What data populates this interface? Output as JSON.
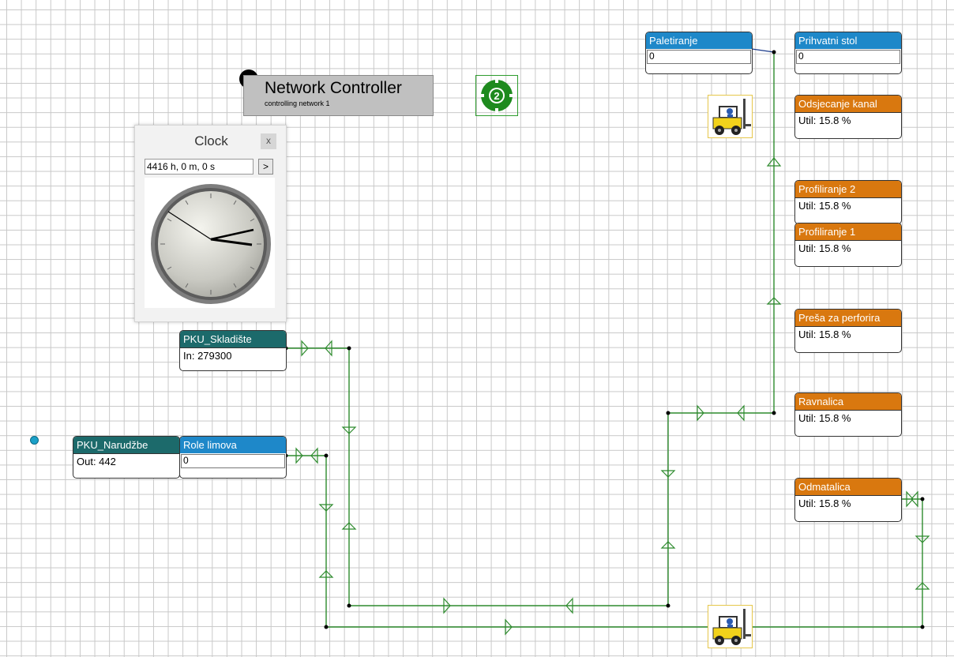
{
  "network_controller": {
    "title": "Network Controller",
    "subtitle": "controlling network 1"
  },
  "network_badge": {
    "label": "2"
  },
  "clock": {
    "title": "Clock",
    "close": "x",
    "time": "4416 h, 0 m, 0 s",
    "go": ">"
  },
  "nodes": {
    "paletiranje": {
      "header": "Paletiranje",
      "value": "0"
    },
    "prihvatni_stol": {
      "header": "Prihvatni stol",
      "value": "0"
    },
    "odsjecanje_kanal": {
      "header": "Odsjecanje kanal",
      "value": "Util: 15.8 %"
    },
    "profiliranje_2": {
      "header": "Profiliranje 2",
      "value": "Util: 15.8 %"
    },
    "profiliranje_1": {
      "header": "Profiliranje 1",
      "value": "Util: 15.8 %"
    },
    "presa_za_perforira": {
      "header": "Preša za perforira",
      "value": "Util: 15.8 %"
    },
    "ravnalica": {
      "header": "Ravnalica",
      "value": "Util: 15.8 %"
    },
    "odmatalica": {
      "header": "Odmatalica",
      "value": "Util: 15.8 %"
    },
    "pku_skladiste": {
      "header": "PKU_Skladište",
      "value": "In: 279300"
    },
    "pku_narudzbe": {
      "header": "PKU_Narudžbe",
      "value": "Out: 442"
    },
    "role_limova": {
      "header": "Role limova",
      "value": "0"
    }
  },
  "colors": {
    "teal": "#1c6a6b",
    "blue": "#1e88c9",
    "orange": "#d9780f",
    "link": "#2e8b2e"
  }
}
